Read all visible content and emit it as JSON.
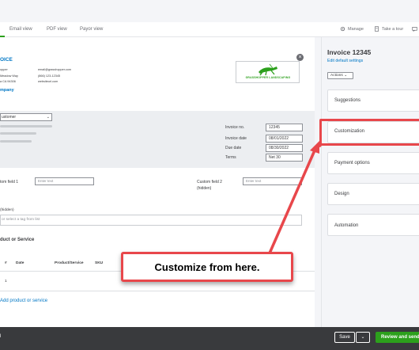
{
  "tabs": {
    "email": "Email view",
    "pdf": "PDF view",
    "payor": "Payor view"
  },
  "toolbar": {
    "manage": "Manage",
    "tour": "Take a tour"
  },
  "invoice": {
    "header_title": "OICE",
    "company_lines": [
      "opper",
      "Meadow Way",
      "a CA 94306"
    ],
    "contact_lines": [
      "email@grasshopper.com",
      "(866) 123-12345",
      "websiteurl.com"
    ],
    "company_link": "mpany",
    "logo_text": "GRASSHOPPER LANDSCAPING",
    "customer_placeholder": "ustomer",
    "meta": [
      {
        "label": "Invoice no.",
        "value": "12345"
      },
      {
        "label": "Invoice date",
        "value": "08/01/2022"
      },
      {
        "label": "Due date",
        "value": "08/30/2022"
      },
      {
        "label": "Terms",
        "value": "Net 30"
      }
    ],
    "custom_field_1_label": "tom field 1",
    "custom_field_1_placeholder": "Enter text",
    "custom_field_2_label_line1": "Custom field 2",
    "custom_field_2_label_line2": "(hidden)",
    "custom_field_2_placeholder": "Enter text",
    "tags_label": "(hidden)",
    "tags_placeholder": "or select a tag from list",
    "section_title": "duct or Service",
    "columns": [
      "#",
      "Date",
      "Product/Service",
      "SKU"
    ],
    "row_number": "1",
    "add_product": "Add product or service"
  },
  "panel": {
    "title": "Invoice 12345",
    "edit_default": "Edit default settings",
    "actions_label": "Actions",
    "cards": [
      "Suggestions",
      "Customization",
      "Payment options",
      "Design",
      "Automation"
    ]
  },
  "callout": {
    "text": "Customize from here."
  },
  "footer": {
    "left_text": "l",
    "save_label": "Save",
    "send_label": "Review and send"
  },
  "colors": {
    "accent_green": "#2ca01c",
    "link_blue": "#0077c5",
    "callout_red": "#e8474b",
    "footer_dark": "#393a3d"
  }
}
